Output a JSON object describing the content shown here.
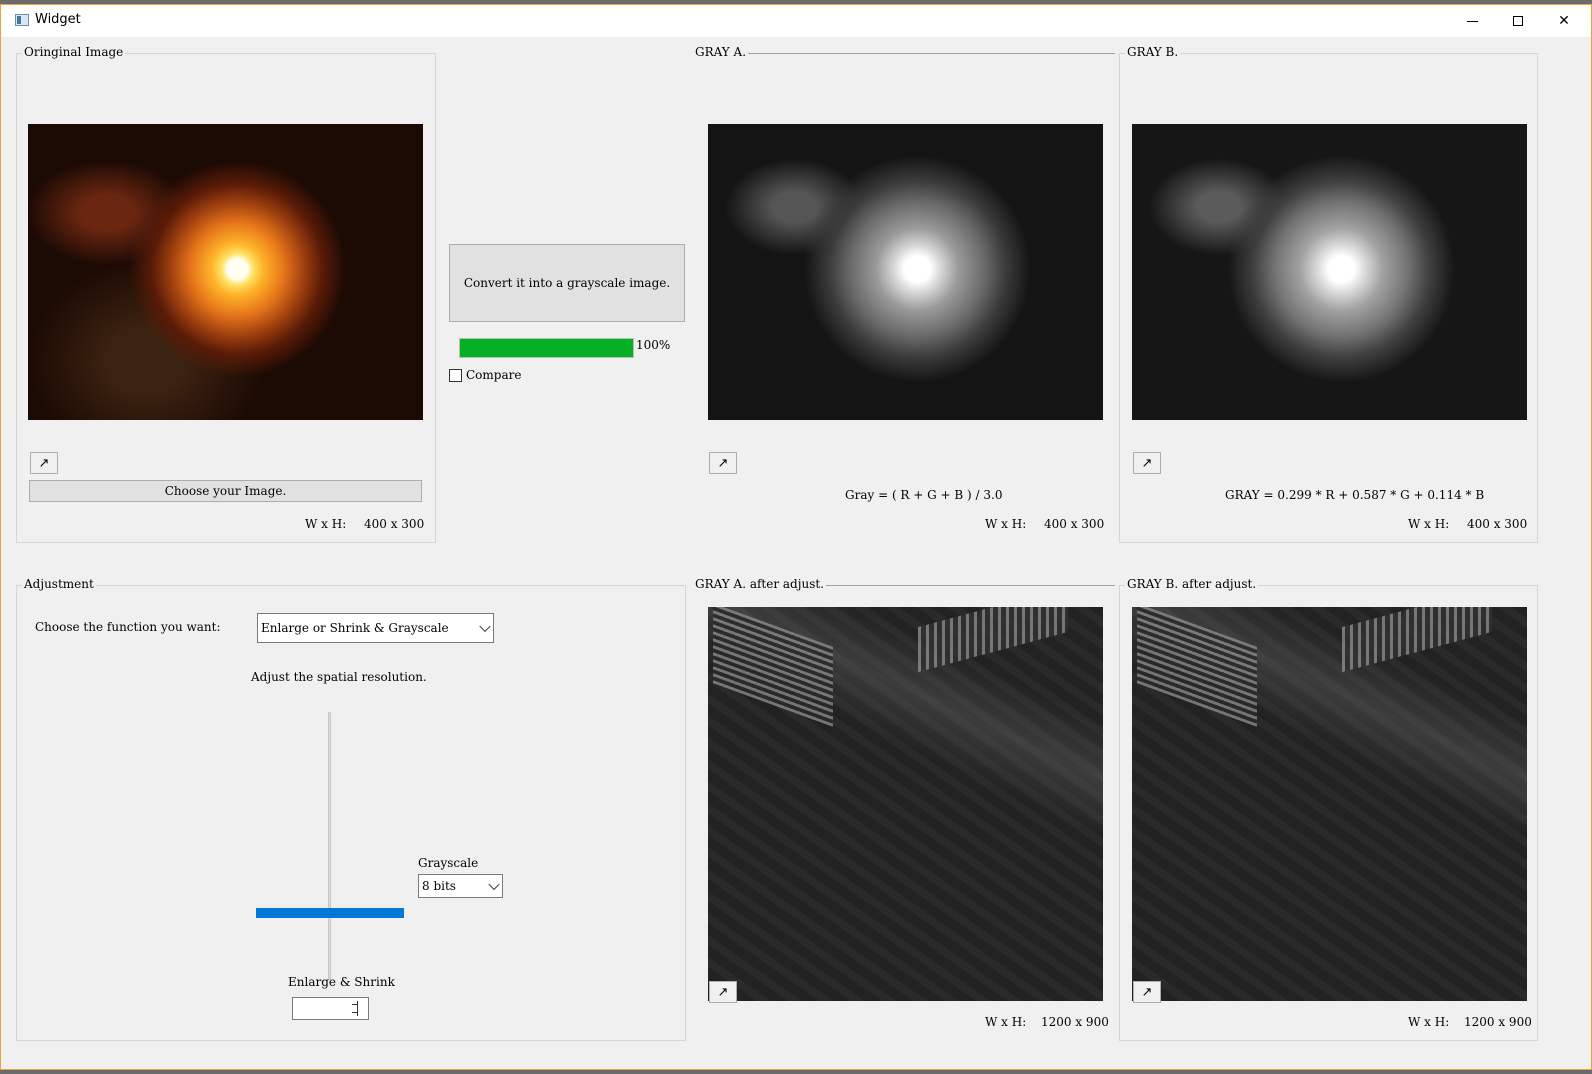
{
  "window": {
    "title": "Widget",
    "min_icon": "minimize-icon",
    "max_icon": "maximize-icon",
    "close_icon": "close-icon",
    "close_glyph": "✕"
  },
  "original": {
    "group_title": "Oringinal Image",
    "zoom_glyph": "↗",
    "choose_button": "Choose your Image.",
    "wh_label": "W x H:",
    "wh_value": "400 x 300"
  },
  "center": {
    "convert_button": "Convert it into a grayscale image.",
    "progress_percent": 100,
    "progress_text": "100%",
    "compare_label": "Compare",
    "compare_checked": false
  },
  "grayA": {
    "group_title": "GRAY A.",
    "zoom_glyph": "↗",
    "formula": "Gray = ( R + G + B ) / 3.0",
    "wh_label": "W x H:",
    "wh_value": "400 x 300"
  },
  "grayB": {
    "group_title": "GRAY B.",
    "zoom_glyph": "↗",
    "formula": "GRAY = 0.299 * R + 0.587 * G + 0.114 * B",
    "wh_label": "W x H:",
    "wh_value": "400 x 300"
  },
  "adjustment": {
    "group_title": "Adjustment",
    "choose_label": "Choose the function you want:",
    "function_selected": "Enlarge or Shrink & Grayscale",
    "spatial_label": "Adjust the spatial resolution.",
    "grayscale_label": "Grayscale",
    "grayscale_selected": "8 bits",
    "enlarge_label": "Enlarge & Shrink",
    "spin_value": ""
  },
  "grayA_adj": {
    "group_title": "GRAY A. after adjust.",
    "zoom_glyph": "↗",
    "wh_label": "W x H:",
    "wh_value": "1200 x 900"
  },
  "grayB_adj": {
    "group_title": "GRAY B. after adjust.",
    "zoom_glyph": "↗",
    "wh_label": "W x H:",
    "wh_value": "1200 x 900"
  },
  "colors": {
    "progress_fill": "#06b025",
    "slider_handle": "#0078d7",
    "window_border": "#e8a33c"
  }
}
